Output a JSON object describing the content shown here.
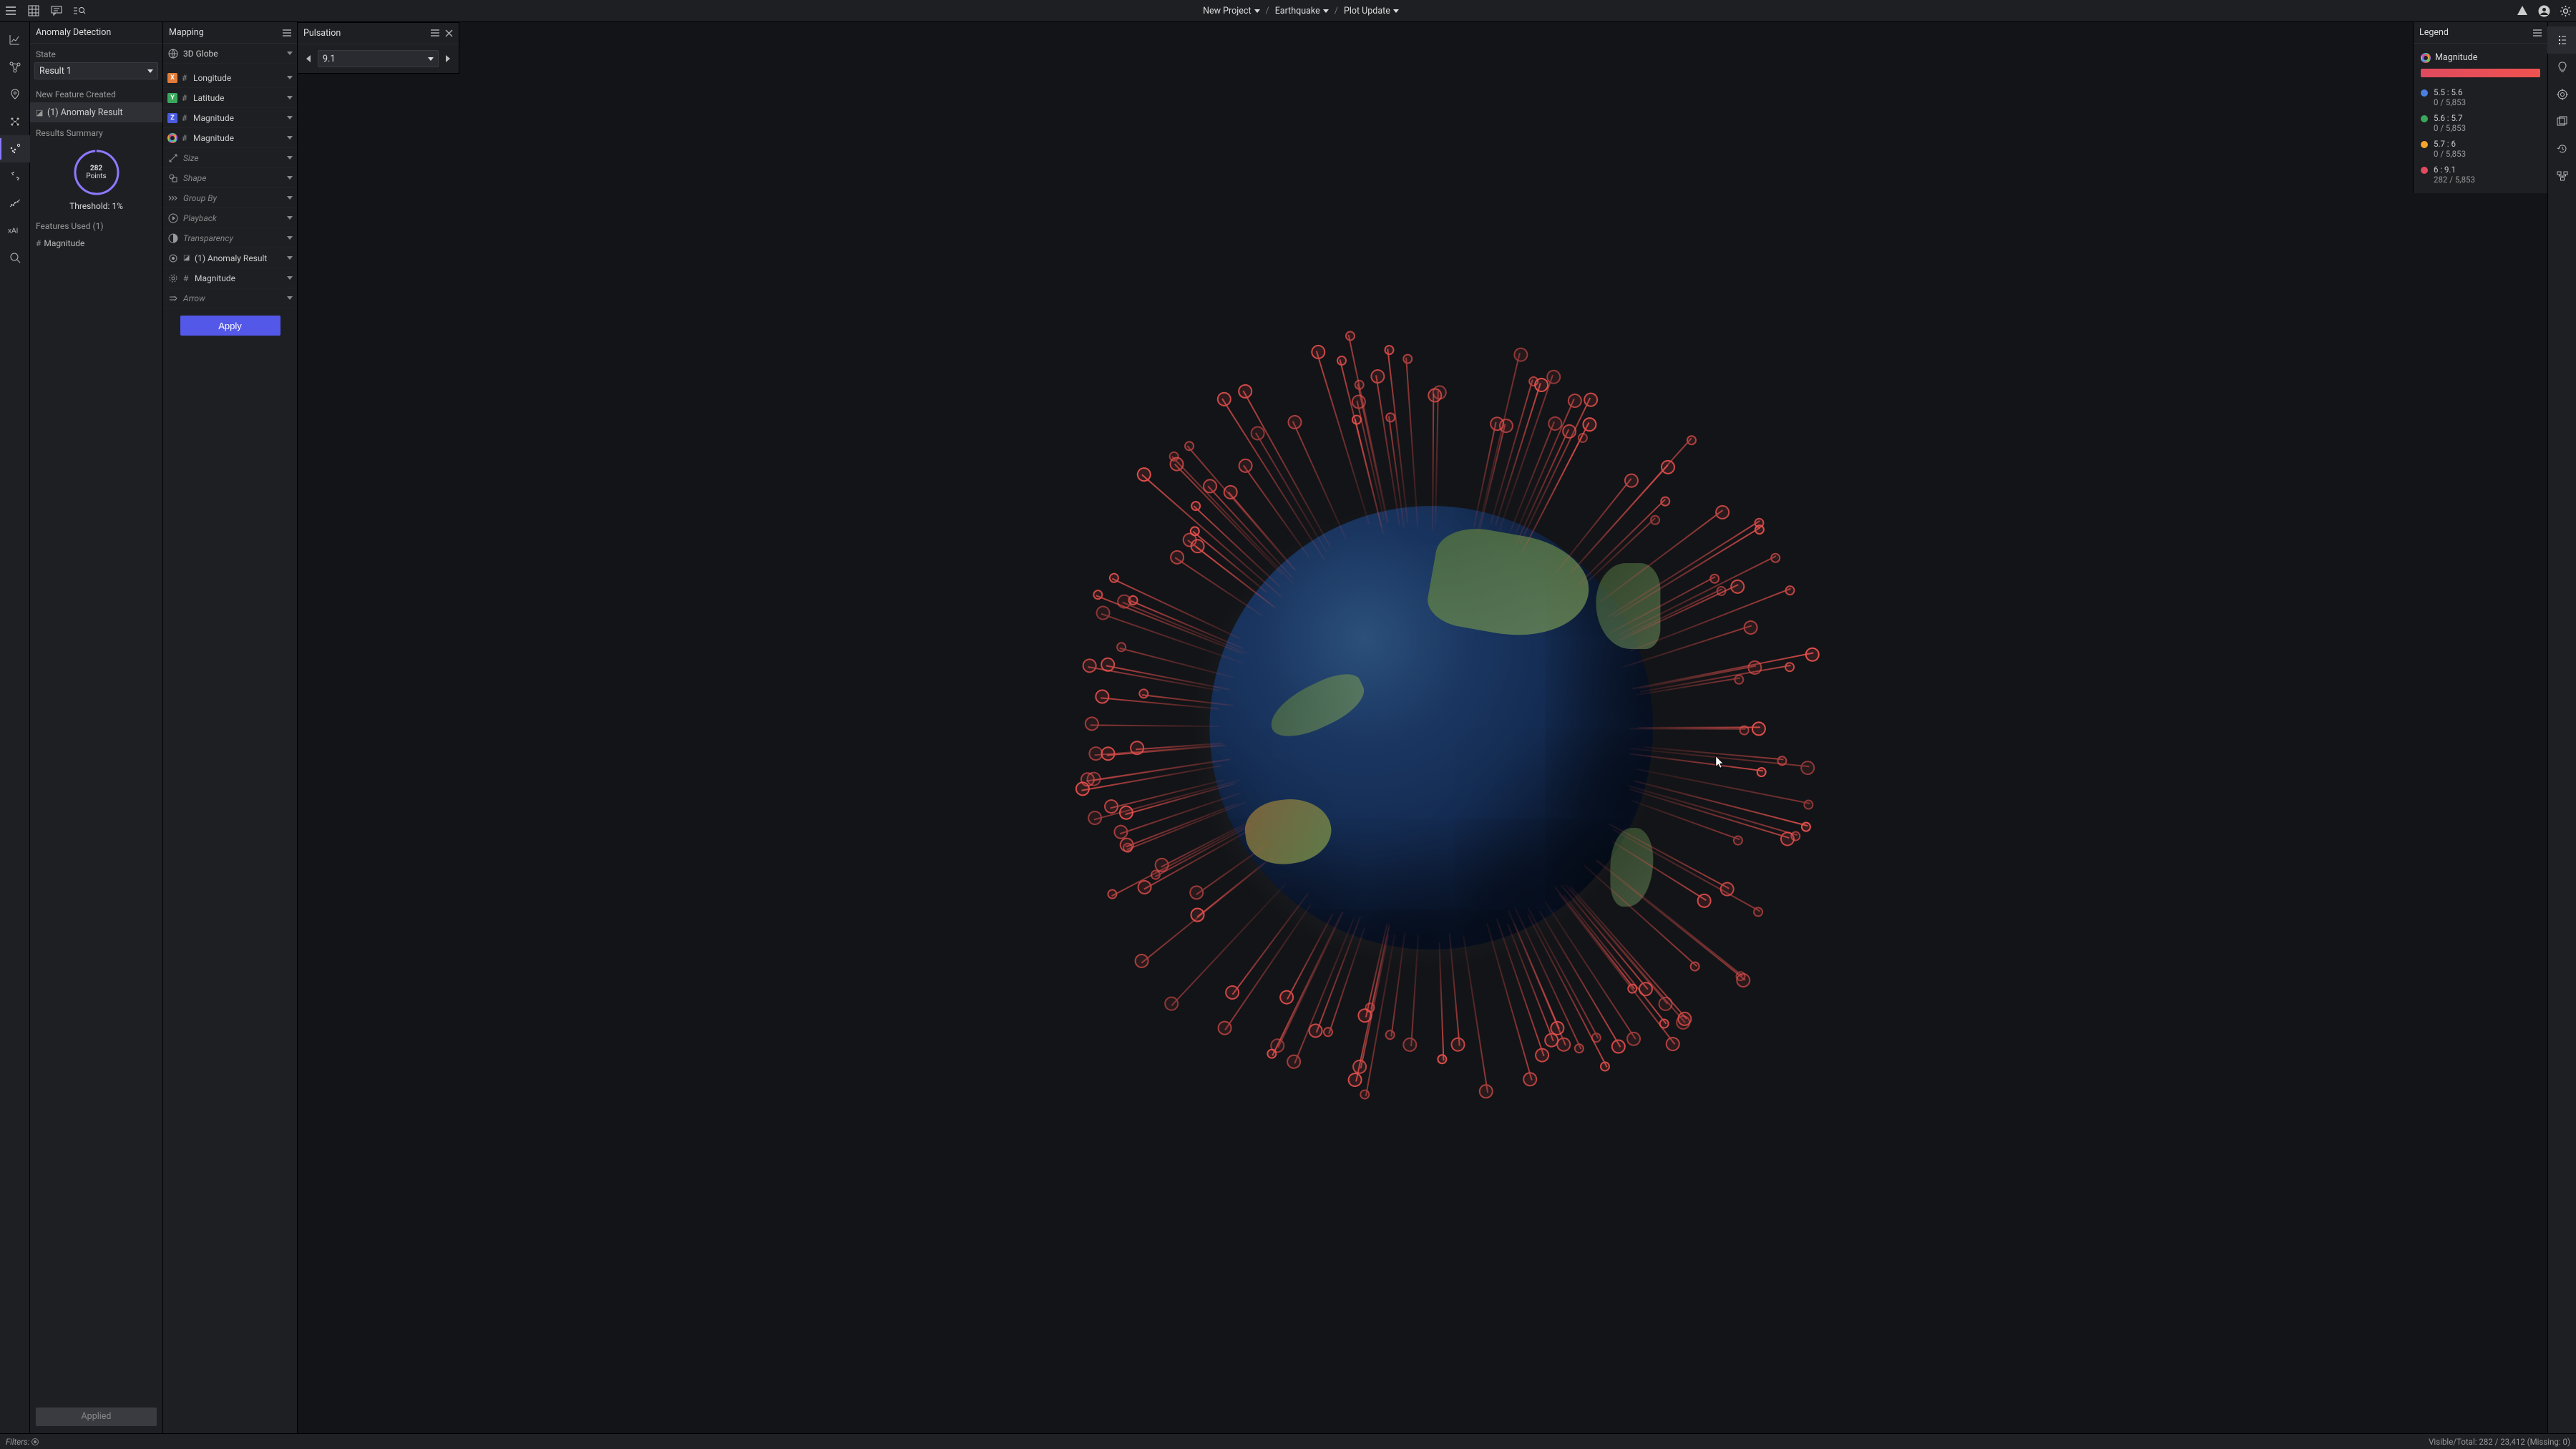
{
  "breadcrumb": {
    "project": "New Project",
    "dataset": "Earthquake",
    "view": "Plot Update"
  },
  "anomaly": {
    "title": "Anomaly Detection",
    "state_label": "State",
    "state_value": "Result 1",
    "new_feature_label": "New Feature Created",
    "result_item": "(1) Anomaly Result",
    "results_summary_label": "Results Summary",
    "donut_count": "282",
    "donut_unit": "Points",
    "threshold": "Threshold: 1%",
    "features_used_label": "Features Used (1)",
    "feature_1": "Magnitude",
    "applied_label": "Applied"
  },
  "mapping": {
    "title": "Mapping",
    "type": "3D Globe",
    "longitude": "Longitude",
    "latitude": "Latitude",
    "magnitude_z": "Magnitude",
    "magnitude_color": "Magnitude",
    "size": "Size",
    "shape": "Shape",
    "groupby": "Group By",
    "playback": "Playback",
    "transparency": "Transparency",
    "halo": "(1) Anomaly Result",
    "pulsation_field": "Magnitude",
    "arrow": "Arrow",
    "apply": "Apply"
  },
  "pulsation": {
    "title": "Pulsation",
    "value": "9.1"
  },
  "legend": {
    "title": "Legend",
    "field": "Magnitude",
    "bins": [
      {
        "range": "5.5 : 5.6",
        "count": "0 / 5,853",
        "color": "#4a7fe0"
      },
      {
        "range": "5.6 : 5.7",
        "count": "0 / 5,853",
        "color": "#3aa85c"
      },
      {
        "range": "5.7 : 6",
        "count": "0 / 5,853",
        "color": "#f6a62a"
      },
      {
        "range": "6 : 9.1",
        "count": "282 / 5,853",
        "color": "#e04a5e"
      }
    ]
  },
  "status": {
    "filters": "Filters:",
    "right": "Visible/Total: 282 / 23,412 (Missing: 0)"
  }
}
